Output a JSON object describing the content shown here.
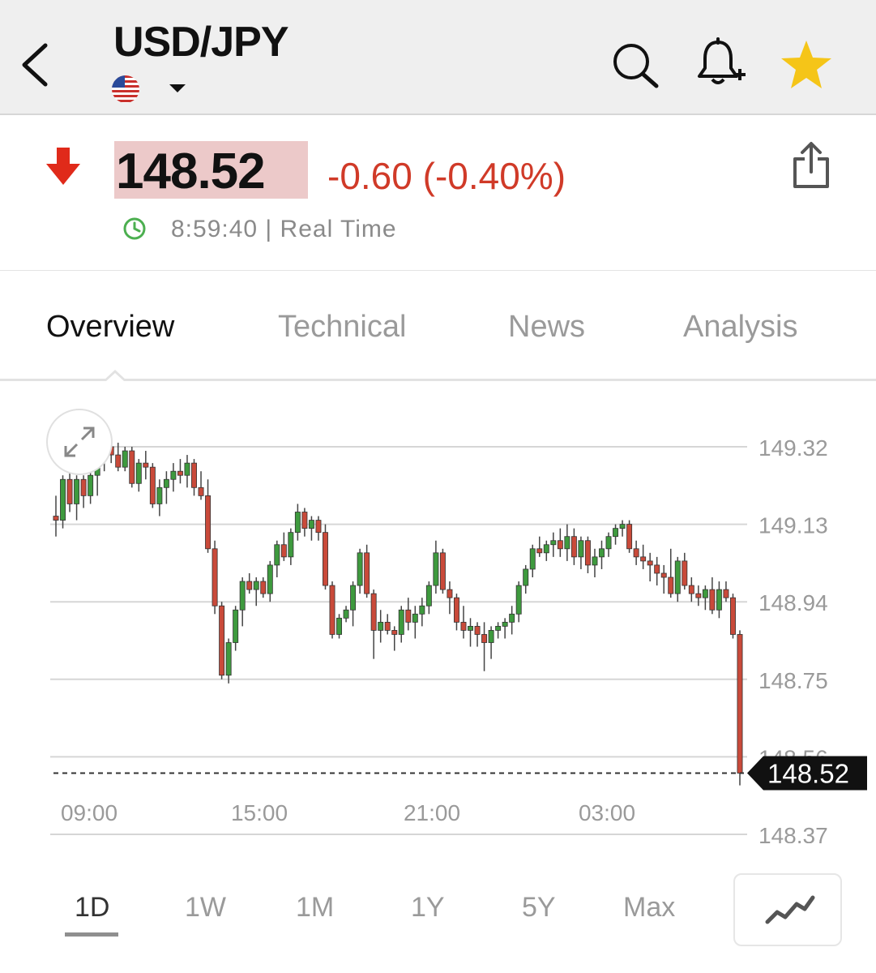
{
  "header": {
    "symbol": "USD/JPY",
    "flag_icon": "us-flag-icon",
    "icons": [
      "back-arrow-icon",
      "search-icon",
      "bell-plus-icon",
      "star-icon"
    ],
    "star_color": "#f5c518"
  },
  "quote": {
    "price": "148.52",
    "change": "-0.60 (-0.40%)",
    "time": "8:59:40 | Real Time",
    "direction_icon": "arrow-down-icon",
    "colors": {
      "down": "#d03a28",
      "price_highlight": "#ecc9c9",
      "clock": "#4caf50"
    }
  },
  "tabs": [
    {
      "label": "Overview",
      "active": true
    },
    {
      "label": "Technical",
      "active": false
    },
    {
      "label": "News",
      "active": false
    },
    {
      "label": "Analysis",
      "active": false
    }
  ],
  "ranges": [
    {
      "label": "1D",
      "active": true
    },
    {
      "label": "1W",
      "active": false
    },
    {
      "label": "1M",
      "active": false
    },
    {
      "label": "1Y",
      "active": false
    },
    {
      "label": "5Y",
      "active": false
    },
    {
      "label": "Max",
      "active": false
    }
  ],
  "chart_data": {
    "type": "candlestick",
    "y_ticks": [
      "149.32",
      "149.13",
      "148.94",
      "148.75",
      "148.56",
      "148.37"
    ],
    "x_ticks": [
      "09:00",
      "15:00",
      "21:00",
      "03:00"
    ],
    "ylim": [
      148.37,
      149.32
    ],
    "current_price": "148.52",
    "colors": {
      "up": "#3e9a3e",
      "down": "#c94a3a"
    },
    "candles": [
      [
        149.15,
        149.2,
        149.1,
        149.14
      ],
      [
        149.14,
        149.25,
        149.12,
        149.24
      ],
      [
        149.24,
        149.26,
        149.16,
        149.18
      ],
      [
        149.18,
        149.25,
        149.14,
        149.24
      ],
      [
        149.24,
        149.25,
        149.17,
        149.2
      ],
      [
        149.2,
        149.26,
        149.18,
        149.25
      ],
      [
        149.25,
        149.3,
        149.2,
        149.29
      ],
      [
        149.29,
        149.33,
        149.26,
        149.32
      ],
      [
        149.32,
        149.33,
        149.28,
        149.3
      ],
      [
        149.3,
        149.33,
        149.26,
        149.27
      ],
      [
        149.27,
        149.32,
        149.26,
        149.31
      ],
      [
        149.31,
        149.32,
        149.22,
        149.23
      ],
      [
        149.23,
        149.29,
        149.21,
        149.28
      ],
      [
        149.28,
        149.31,
        149.24,
        149.27
      ],
      [
        149.27,
        149.28,
        149.17,
        149.18
      ],
      [
        149.18,
        149.24,
        149.15,
        149.22
      ],
      [
        149.22,
        149.26,
        149.18,
        149.24
      ],
      [
        149.24,
        149.28,
        149.21,
        149.26
      ],
      [
        149.26,
        149.29,
        149.23,
        149.25
      ],
      [
        149.25,
        149.3,
        149.22,
        149.28
      ],
      [
        149.28,
        149.29,
        149.2,
        149.22
      ],
      [
        149.22,
        149.26,
        149.19,
        149.2
      ],
      [
        149.2,
        149.24,
        149.06,
        149.07
      ],
      [
        149.07,
        149.09,
        148.91,
        148.93
      ],
      [
        148.93,
        148.94,
        148.75,
        148.76
      ],
      [
        148.76,
        148.85,
        148.74,
        148.84
      ],
      [
        148.84,
        148.93,
        148.82,
        148.92
      ],
      [
        148.92,
        149.0,
        148.88,
        148.99
      ],
      [
        148.99,
        149.01,
        148.96,
        148.97
      ],
      [
        148.97,
        149.0,
        148.93,
        148.99
      ],
      [
        148.99,
        149.0,
        148.95,
        148.96
      ],
      [
        148.96,
        149.04,
        148.94,
        149.03
      ],
      [
        149.03,
        149.09,
        149.0,
        149.08
      ],
      [
        149.08,
        149.11,
        149.04,
        149.05
      ],
      [
        149.05,
        149.12,
        149.03,
        149.11
      ],
      [
        149.11,
        149.18,
        149.09,
        149.16
      ],
      [
        149.16,
        149.17,
        149.1,
        149.12
      ],
      [
        149.12,
        149.15,
        149.09,
        149.14
      ],
      [
        149.14,
        149.15,
        149.09,
        149.11
      ],
      [
        149.11,
        149.13,
        148.97,
        148.98
      ],
      [
        148.98,
        148.99,
        148.85,
        148.86
      ],
      [
        148.86,
        148.91,
        148.85,
        148.9
      ],
      [
        148.9,
        148.93,
        148.89,
        148.92
      ],
      [
        148.92,
        148.99,
        148.88,
        148.98
      ],
      [
        148.98,
        149.07,
        148.96,
        149.06
      ],
      [
        149.06,
        149.08,
        148.95,
        148.96
      ],
      [
        148.96,
        148.97,
        148.8,
        148.87
      ],
      [
        148.87,
        148.92,
        148.84,
        148.89
      ],
      [
        148.89,
        148.91,
        148.86,
        148.87
      ],
      [
        148.87,
        148.88,
        148.82,
        148.86
      ],
      [
        148.86,
        148.93,
        148.84,
        148.92
      ],
      [
        148.92,
        148.95,
        148.87,
        148.89
      ],
      [
        148.89,
        148.93,
        148.85,
        148.91
      ],
      [
        148.91,
        148.95,
        148.88,
        148.93
      ],
      [
        148.93,
        148.99,
        148.91,
        148.98
      ],
      [
        148.98,
        149.09,
        148.96,
        149.06
      ],
      [
        149.06,
        149.07,
        148.96,
        148.97
      ],
      [
        148.97,
        148.99,
        148.91,
        148.95
      ],
      [
        148.95,
        148.96,
        148.87,
        148.89
      ],
      [
        148.89,
        148.93,
        148.85,
        148.87
      ],
      [
        148.87,
        148.9,
        148.83,
        148.88
      ],
      [
        148.88,
        148.89,
        148.83,
        148.86
      ],
      [
        148.86,
        148.89,
        148.77,
        148.84
      ],
      [
        148.84,
        148.88,
        148.8,
        148.87
      ],
      [
        148.87,
        148.89,
        148.85,
        148.88
      ],
      [
        148.88,
        148.9,
        148.85,
        148.89
      ],
      [
        148.89,
        148.93,
        148.86,
        148.91
      ],
      [
        148.91,
        148.99,
        148.89,
        148.98
      ],
      [
        148.98,
        149.03,
        148.96,
        149.02
      ],
      [
        149.02,
        149.08,
        149.0,
        149.07
      ],
      [
        149.07,
        149.1,
        149.05,
        149.06
      ],
      [
        149.06,
        149.09,
        149.04,
        149.08
      ],
      [
        149.08,
        149.11,
        149.05,
        149.09
      ],
      [
        149.09,
        149.12,
        149.05,
        149.07
      ],
      [
        149.07,
        149.13,
        149.04,
        149.1
      ],
      [
        149.1,
        149.12,
        149.03,
        149.05
      ],
      [
        149.05,
        149.1,
        149.02,
        149.09
      ],
      [
        149.09,
        149.1,
        149.01,
        149.03
      ],
      [
        149.03,
        149.07,
        149.0,
        149.05
      ],
      [
        149.05,
        149.09,
        149.02,
        149.07
      ],
      [
        149.07,
        149.11,
        149.05,
        149.1
      ],
      [
        149.1,
        149.13,
        149.08,
        149.12
      ],
      [
        149.12,
        149.14,
        149.1,
        149.13
      ],
      [
        149.13,
        149.14,
        149.06,
        149.07
      ],
      [
        149.07,
        149.09,
        149.03,
        149.05
      ],
      [
        149.05,
        149.08,
        149.02,
        149.04
      ],
      [
        149.04,
        149.06,
        148.99,
        149.03
      ],
      [
        149.03,
        149.05,
        148.98,
        149.01
      ],
      [
        149.01,
        149.03,
        148.96,
        149.0
      ],
      [
        149.0,
        149.07,
        148.95,
        148.96
      ],
      [
        148.96,
        149.05,
        148.94,
        149.04
      ],
      [
        149.04,
        149.06,
        148.97,
        148.98
      ],
      [
        148.98,
        149.0,
        148.94,
        148.96
      ],
      [
        148.96,
        148.98,
        148.93,
        148.95
      ],
      [
        148.95,
        148.98,
        148.92,
        148.97
      ],
      [
        148.97,
        149.0,
        148.91,
        148.92
      ],
      [
        148.92,
        148.99,
        148.9,
        148.97
      ],
      [
        148.97,
        148.99,
        148.94,
        148.95
      ],
      [
        148.95,
        148.96,
        148.85,
        148.86
      ],
      [
        148.86,
        148.87,
        148.49,
        148.52
      ]
    ]
  },
  "chart_type_icon": "line-chart-icon",
  "expand_icon": "expand-icon"
}
